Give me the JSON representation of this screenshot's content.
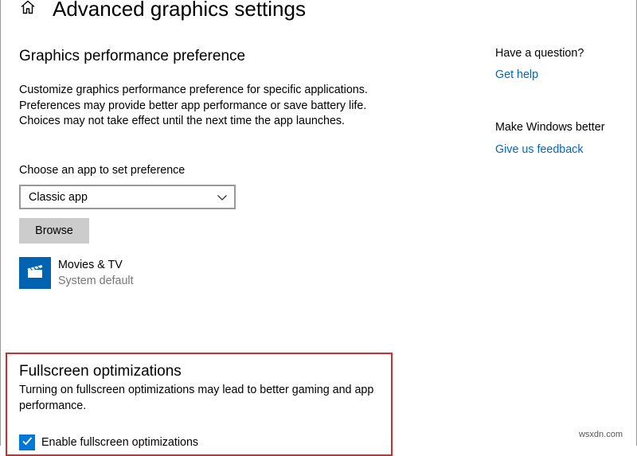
{
  "header": {
    "title": "Advanced graphics settings",
    "home_icon": "home-icon"
  },
  "graphics_pref": {
    "title": "Graphics performance preference",
    "description": "Customize graphics performance preference for specific applications. Preferences may provide better app performance or save battery life. Choices may not take effect until the next time the app launches.",
    "dropdown_label": "Choose an app to set preference",
    "dropdown_value": "Classic app",
    "browse_label": "Browse",
    "app": {
      "name": "Movies & TV",
      "preference": "System default",
      "icon": "clapperboard-icon"
    }
  },
  "fullscreen": {
    "title": "Fullscreen optimizations",
    "description": "Turning on fullscreen optimizations may lead to better gaming and app performance.",
    "checkbox_label": "Enable fullscreen optimizations",
    "checked": true
  },
  "sidebar": {
    "question_heading": "Have a question?",
    "help_link": "Get help",
    "feedback_heading": "Make Windows better",
    "feedback_link": "Give us feedback"
  },
  "watermark": "wsxdn.com",
  "colors": {
    "accent": "#0078d7",
    "link": "#0067c0",
    "tile": "#0063b1",
    "highlight": "#d12b2b",
    "button": "#cccccc"
  }
}
